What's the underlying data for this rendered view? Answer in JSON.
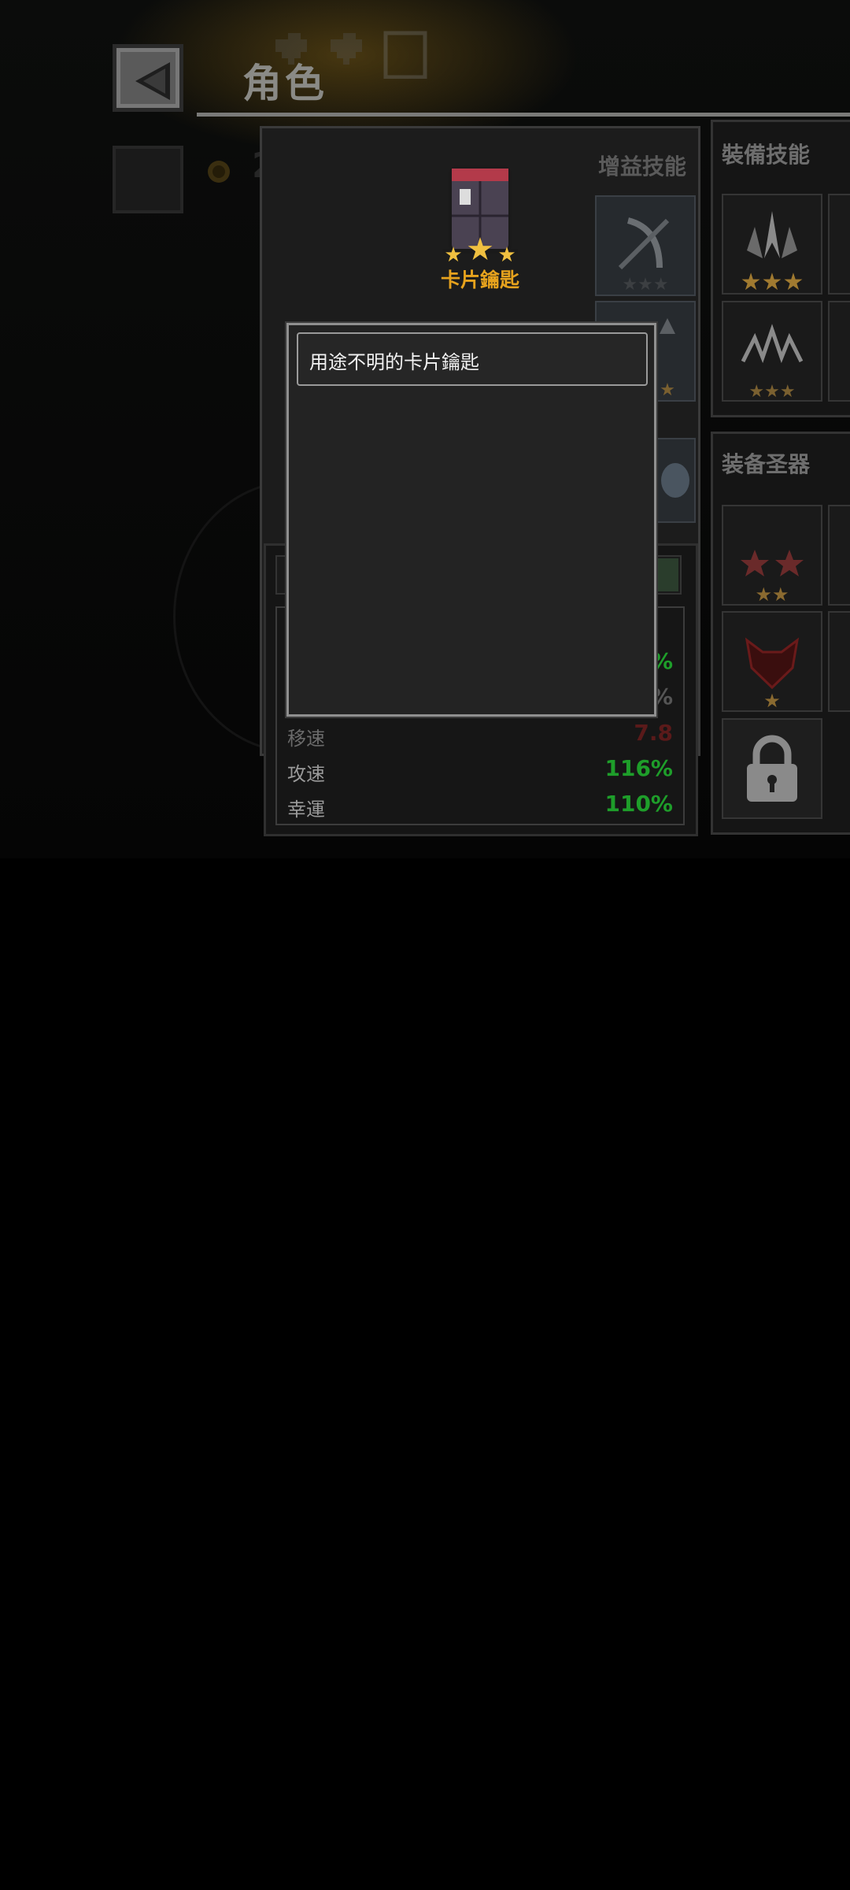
{
  "header": {
    "title": "角色"
  },
  "currency": {
    "coins": "2550"
  },
  "buff_panel": {
    "title": "增益技能"
  },
  "equip_skills": {
    "title": "裝備技能"
  },
  "equip_relics": {
    "title": "装备圣器"
  },
  "item": {
    "name": "卡片鑰匙",
    "stars": 3,
    "description": "用途不明的卡片鑰匙"
  },
  "stats": [
    {
      "label": "移速",
      "value": "7.8",
      "color": "#8a1c1c"
    },
    {
      "label": "攻速",
      "value": "116%",
      "color": "#1e9e2a"
    },
    {
      "label": "幸運",
      "value": "110%",
      "color": "#1e9e2a"
    }
  ],
  "hidden_stat_values": [
    "%",
    "%"
  ],
  "colors": {
    "accent_gold": "#e6a21d",
    "positive": "#1e9e2a",
    "negative": "#8a1c1c"
  }
}
